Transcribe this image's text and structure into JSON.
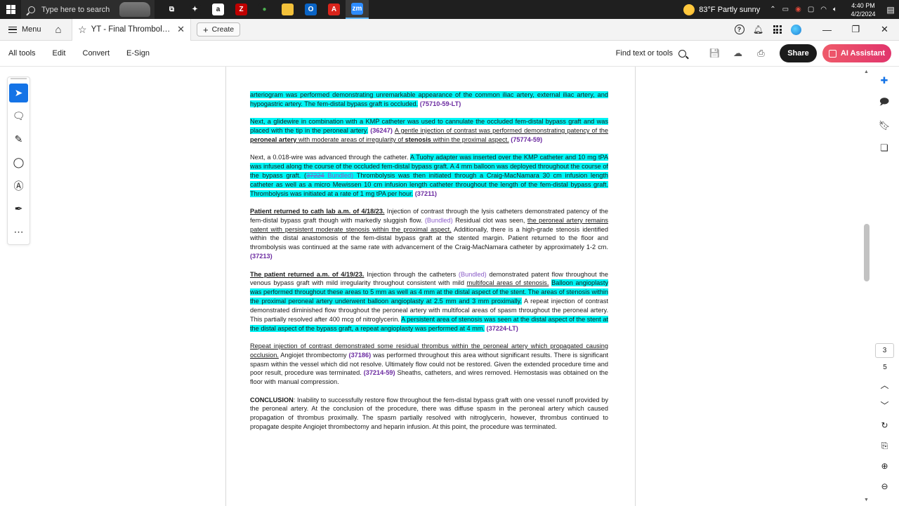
{
  "taskbar": {
    "search_placeholder": "Type here to search",
    "apps": [
      {
        "name": "task-view",
        "glyph": "⧉",
        "color": "#1f1f1f",
        "text": "#fff"
      },
      {
        "name": "dropbox",
        "glyph": "✦",
        "color": "#1f1f1f",
        "text": "#fff"
      },
      {
        "name": "amazon",
        "glyph": "a",
        "color": "#ffffff",
        "text": "#111"
      },
      {
        "name": "filezilla",
        "glyph": "Z",
        "color": "#bf0000",
        "text": "#fff"
      },
      {
        "name": "chrome",
        "glyph": "●",
        "color": "#1f1f1f",
        "text": "#4caf50"
      },
      {
        "name": "file-explorer",
        "glyph": "▬",
        "color": "#f3c13a",
        "text": "#f3c13a"
      },
      {
        "name": "outlook",
        "glyph": "O",
        "color": "#0a64c5",
        "text": "#fff"
      },
      {
        "name": "acrobat",
        "glyph": "A",
        "color": "#d9241b",
        "text": "#fff"
      },
      {
        "name": "zoom",
        "glyph": "zm",
        "color": "#2d8cff",
        "text": "#fff"
      }
    ],
    "weather": "83°F  Partly sunny",
    "time": "4:40 PM",
    "date": "4/2/2024"
  },
  "titlebar": {
    "menu_label": "Menu",
    "doc_title": "YT - Final Thrombolysis, ...",
    "create_label": "Create"
  },
  "toolbar": {
    "tabs": [
      "All tools",
      "Edit",
      "Convert",
      "E-Sign"
    ],
    "find_label": "Find text or tools",
    "share_label": "Share",
    "ai_label": "AI Assistant"
  },
  "page_nav": {
    "current": "3",
    "total": "5"
  },
  "document": {
    "p1": {
      "t1": "arteriogram was performed demonstrating unremarkable appearance of the common iliac artery, external iliac artery, and hypogastric artery. The fem-distal bypass graft is occluded.",
      "c1": " (75710-59-LT)"
    },
    "p2": {
      "t1": "Next, a glidewire in combination with a KMP catheter was used to cannulate the occluded fem-distal bypass graft and was placed with the tip in the peroneal artery.",
      "c1": " (36247) ",
      "t2": "A gentle injection of contrast was performed demonstrating patency of the ",
      "t3": "peroneal artery",
      "t4": " with moderate areas of irregularity of ",
      "t5": "stenosis",
      "t6": " within the proximal aspect.",
      "c2": " (75774-59)"
    },
    "p3": {
      "t1": "Next, a 0.018-wire was advanced through the catheter. ",
      "t2": "A Tuohy adapter was inserted over the KMP catheter and 10 mg tPA was infused along the course of the occluded fem-distal bypass graft. A 4 mm balloon was deployed throughout the course of the bypass graft. (",
      "t3": "37224",
      "t4": " Bundled)",
      "t5": " Thrombolysis was then initiated through a Craig-MacNamara 30 cm infusion length catheter as well as a micro Mewissen 10 cm infusion length catheter throughout the length of the fem-distal bypass graft. Thrombolysis was initiated at a rate of 1 mg tPA per hour.",
      "c1": " (37211)"
    },
    "p4": {
      "t1": "Patient returned to cath lab a.m. of 4/18/23.",
      "t2": " Injection of contrast through the lysis catheters demonstrated patency of the fem-distal bypass graft though with markedly sluggish flow. ",
      "t3": "(Bundled)",
      "t4": " Residual clot was seen, ",
      "t5": "the peroneal artery remains patent with persistent moderate stenosis within the proximal aspect.",
      "t6": " Additionally, there is a high-grade stenosis identified within the distal anastomosis of the fem-distal bypass graft at the stented margin. Patient returned to the floor and thrombolysis was continued at the same rate with advancement of the Craig-MacNamara catheter by approximately 1-2 cm.",
      "c1": " (37213)"
    },
    "p5": {
      "t1": "The patient returned a.m. of 4/19/23.",
      "t2": " Injection through the catheters ",
      "t3": "(Bundled)",
      "t4": " demonstrated patent flow throughout the venous bypass graft with mild irregularity throughout consistent with mild ",
      "t5": "multifocal areas of stenosis.",
      "t6": " ",
      "t7": "Balloon angioplasty was performed throughout these areas to 5 mm as well as 4 mm at the distal aspect of the stent. The areas of stenosis within the proximal peroneal artery underwent balloon angioplasty at 2.5 mm and 3 mm proximally.",
      "t8": " A repeat injection of contrast demonstrated diminished flow throughout the peroneal artery with multifocal areas of spasm throughout the peroneal artery. This partially resolved after 400 mcg of nitroglycerin. ",
      "t9": "A persistent area of stenosis was seen at the distal aspect of the stent at the distal aspect of the bypass graft, a repeat angioplasty was performed at 4 mm.",
      "c1": " (37224-LT)"
    },
    "p6": {
      "t1": "Repeat injection of contrast demonstrated some residual thrombus within the peroneal artery which propagated causing occlusion.",
      "t2": " Angiojet thrombectomy ",
      "c1": "(37186)",
      "t3": " was performed throughout this area without significant results. There is significant spasm within the vessel which did not resolve. Ultimately flow could not be restored. Given the extended procedure time and poor result, procedure was terminated. ",
      "c2": "(37214-59)",
      "t4": " Sheaths, catheters, and wires removed. Hemostasis was obtained on the floor with manual compression."
    },
    "p7": {
      "t1": "CONCLUSION",
      "t2": ": Inability to successfully restore flow throughout the fem-distal bypass graft with one vessel runoff provided by the peroneal artery. At the conclusion of the procedure, there was diffuse spasm in the peroneal artery which caused propagation of thrombus proximally. The spasm partially resolved with nitroglycerin, however, thrombus continued to propagate despite Angiojet thrombectomy and heparin infusion. At this point, the procedure was terminated."
    }
  }
}
